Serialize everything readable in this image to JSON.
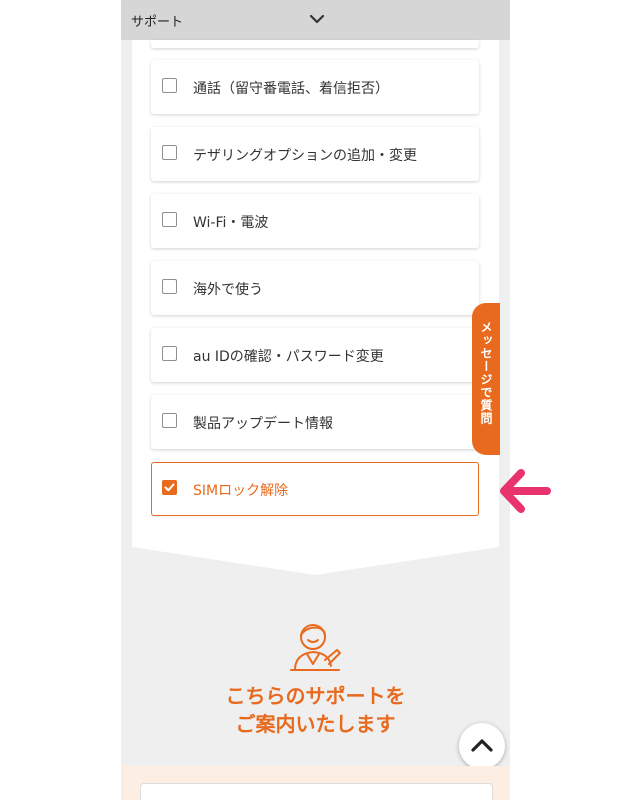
{
  "header": {
    "title": "サポート",
    "chevron_icon": "chevron-down-icon"
  },
  "checklist": [
    {
      "label": "通話（留守番電話、着信拒否）",
      "checked": false
    },
    {
      "label": "テザリングオプションの追加・変更",
      "checked": false
    },
    {
      "label": "Wi-Fi・電波",
      "checked": false
    },
    {
      "label": "海外で使う",
      "checked": false
    },
    {
      "label": "au IDの確認・パスワード変更",
      "checked": false
    },
    {
      "label": "製品アップデート情報",
      "checked": false
    },
    {
      "label": "SIMロック解除",
      "checked": true
    }
  ],
  "message_tab": {
    "label": "メッセージで質問"
  },
  "support": {
    "line1": "こちらのサポートを",
    "line2": "ご案内いたします"
  },
  "colors": {
    "accent": "#e86a1e",
    "arrow": "#e8336d"
  }
}
